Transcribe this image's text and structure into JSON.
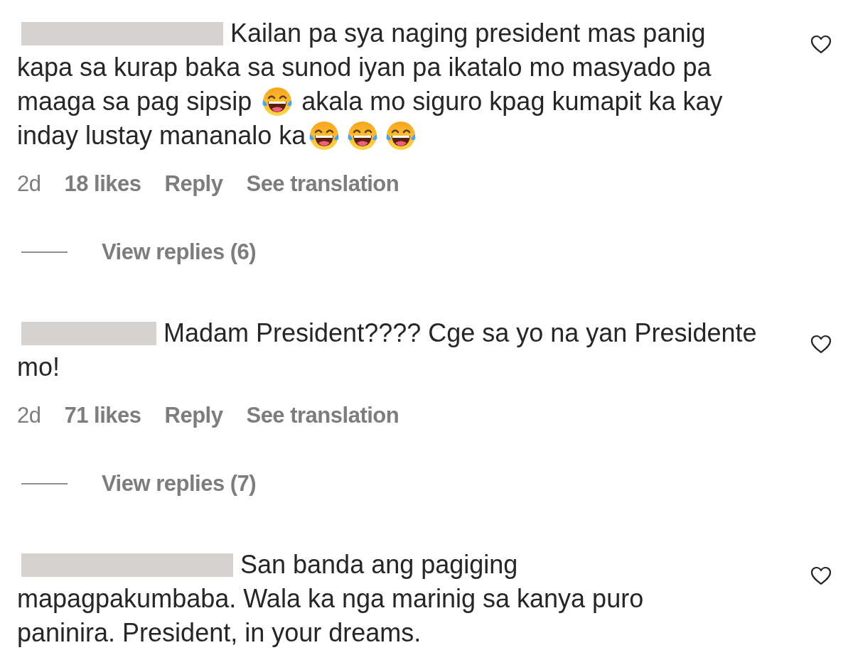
{
  "comments": [
    {
      "lines": [
        [
          {
            "kind": "text",
            "text": "Kailan pa sya naging president mas panig"
          }
        ],
        [
          {
            "kind": "text",
            "text": "kapa sa kurap baka sa sunod iyan pa ikatalo mo masyado pa"
          }
        ],
        [
          {
            "kind": "text",
            "text": "maaga sa pag sipsip"
          },
          {
            "kind": "emoji"
          },
          {
            "kind": "text",
            "text": "akala mo siguro kpag kumapit ka kay"
          }
        ],
        [
          {
            "kind": "text",
            "text": "inday lustay mananalo ka"
          },
          {
            "kind": "emoji"
          },
          {
            "kind": "emoji"
          },
          {
            "kind": "emoji"
          }
        ]
      ],
      "liked": false,
      "time": "2d",
      "likes": "18 likes",
      "reply": "Reply",
      "translation": "See translation",
      "view_replies": "View replies (6)"
    },
    {
      "lines": [
        [
          {
            "kind": "text",
            "text": "Madam President???? Cge sa yo na yan Presidente"
          }
        ],
        [
          {
            "kind": "text",
            "text": "mo!"
          }
        ]
      ],
      "liked": false,
      "time": "2d",
      "likes": "71 likes",
      "reply": "Reply",
      "translation": "See translation",
      "view_replies": "View replies (7)"
    },
    {
      "lines": [
        [
          {
            "kind": "text",
            "text": "San banda ang pagiging"
          }
        ],
        [
          {
            "kind": "text",
            "text": "mapagpakumbaba. Wala ka nga marinig sa kanya puro"
          }
        ],
        [
          {
            "kind": "text",
            "text": "paninira. President, in your dreams."
          }
        ]
      ],
      "liked": false
    }
  ]
}
